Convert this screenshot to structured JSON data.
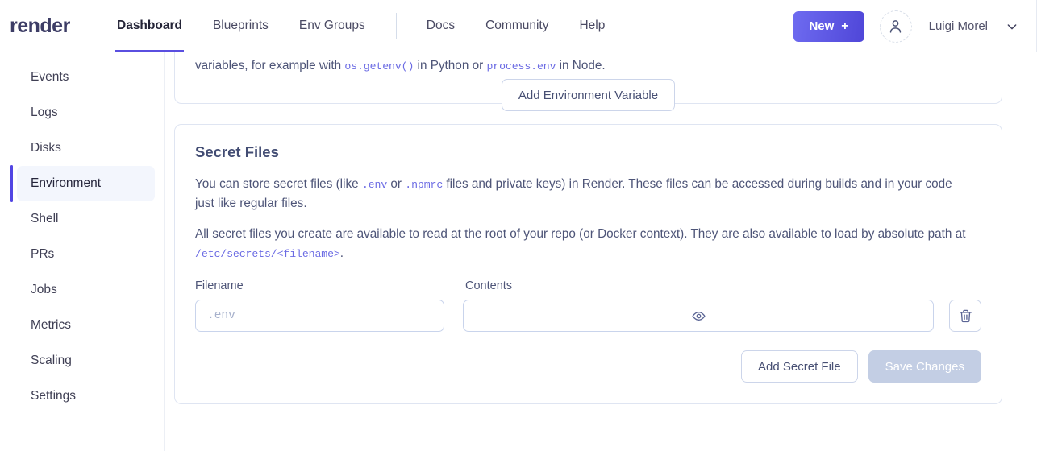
{
  "navbar": {
    "brand": "render",
    "links": [
      {
        "label": "Dashboard",
        "active": true
      },
      {
        "label": "Blueprints",
        "active": false
      },
      {
        "label": "Env Groups",
        "active": false
      },
      {
        "label": "Docs",
        "active": false
      },
      {
        "label": "Community",
        "active": false
      },
      {
        "label": "Help",
        "active": false
      }
    ],
    "new_button_label": "New",
    "new_button_plus": "+",
    "user_name": "Luigi Morel",
    "accent_color": "#5a4fe0",
    "icons": {
      "avatar": "user-icon",
      "chevron": "chevron-down-icon"
    }
  },
  "sidebar": {
    "items": [
      {
        "label": "Events",
        "active": false
      },
      {
        "label": "Logs",
        "active": false
      },
      {
        "label": "Disks",
        "active": false
      },
      {
        "label": "Environment",
        "active": true
      },
      {
        "label": "Shell",
        "active": false
      },
      {
        "label": "PRs",
        "active": false
      },
      {
        "label": "Jobs",
        "active": false
      },
      {
        "label": "Metrics",
        "active": false
      },
      {
        "label": "Scaling",
        "active": false
      },
      {
        "label": "Settings",
        "active": false
      }
    ],
    "active_bg": "#f3f6fd",
    "active_accent": "#5246e3"
  },
  "env_card": {
    "text_1": "variables, for example with ",
    "code_1": "os.getenv()",
    "text_2": " in Python or ",
    "code_2": "process.env",
    "text_3": " in Node.",
    "add_button_label": "Add Environment Variable"
  },
  "secret_files": {
    "title": "Secret Files",
    "para1_a": "You can store secret files (like ",
    "para1_code1": ".env",
    "para1_b": " or ",
    "para1_code2": ".npmrc",
    "para1_c": " files and private keys) in Render. These files can be accessed during builds and in your code just like regular files.",
    "para2_a": "All secret files you create are available to read at the root of your repo (or Docker context). They are also available to load by absolute path at ",
    "para2_code": "/etc/secrets/<filename>",
    "para2_b": ".",
    "labels": {
      "filename": "Filename",
      "contents": "Contents"
    },
    "filename_placeholder": ".env",
    "contents_value": "",
    "icons": {
      "reveal": "eye-icon",
      "delete": "trash-icon"
    },
    "add_secret_label": "Add Secret File",
    "save_label": "Save Changes",
    "save_disabled_color": "#c3cee4"
  }
}
